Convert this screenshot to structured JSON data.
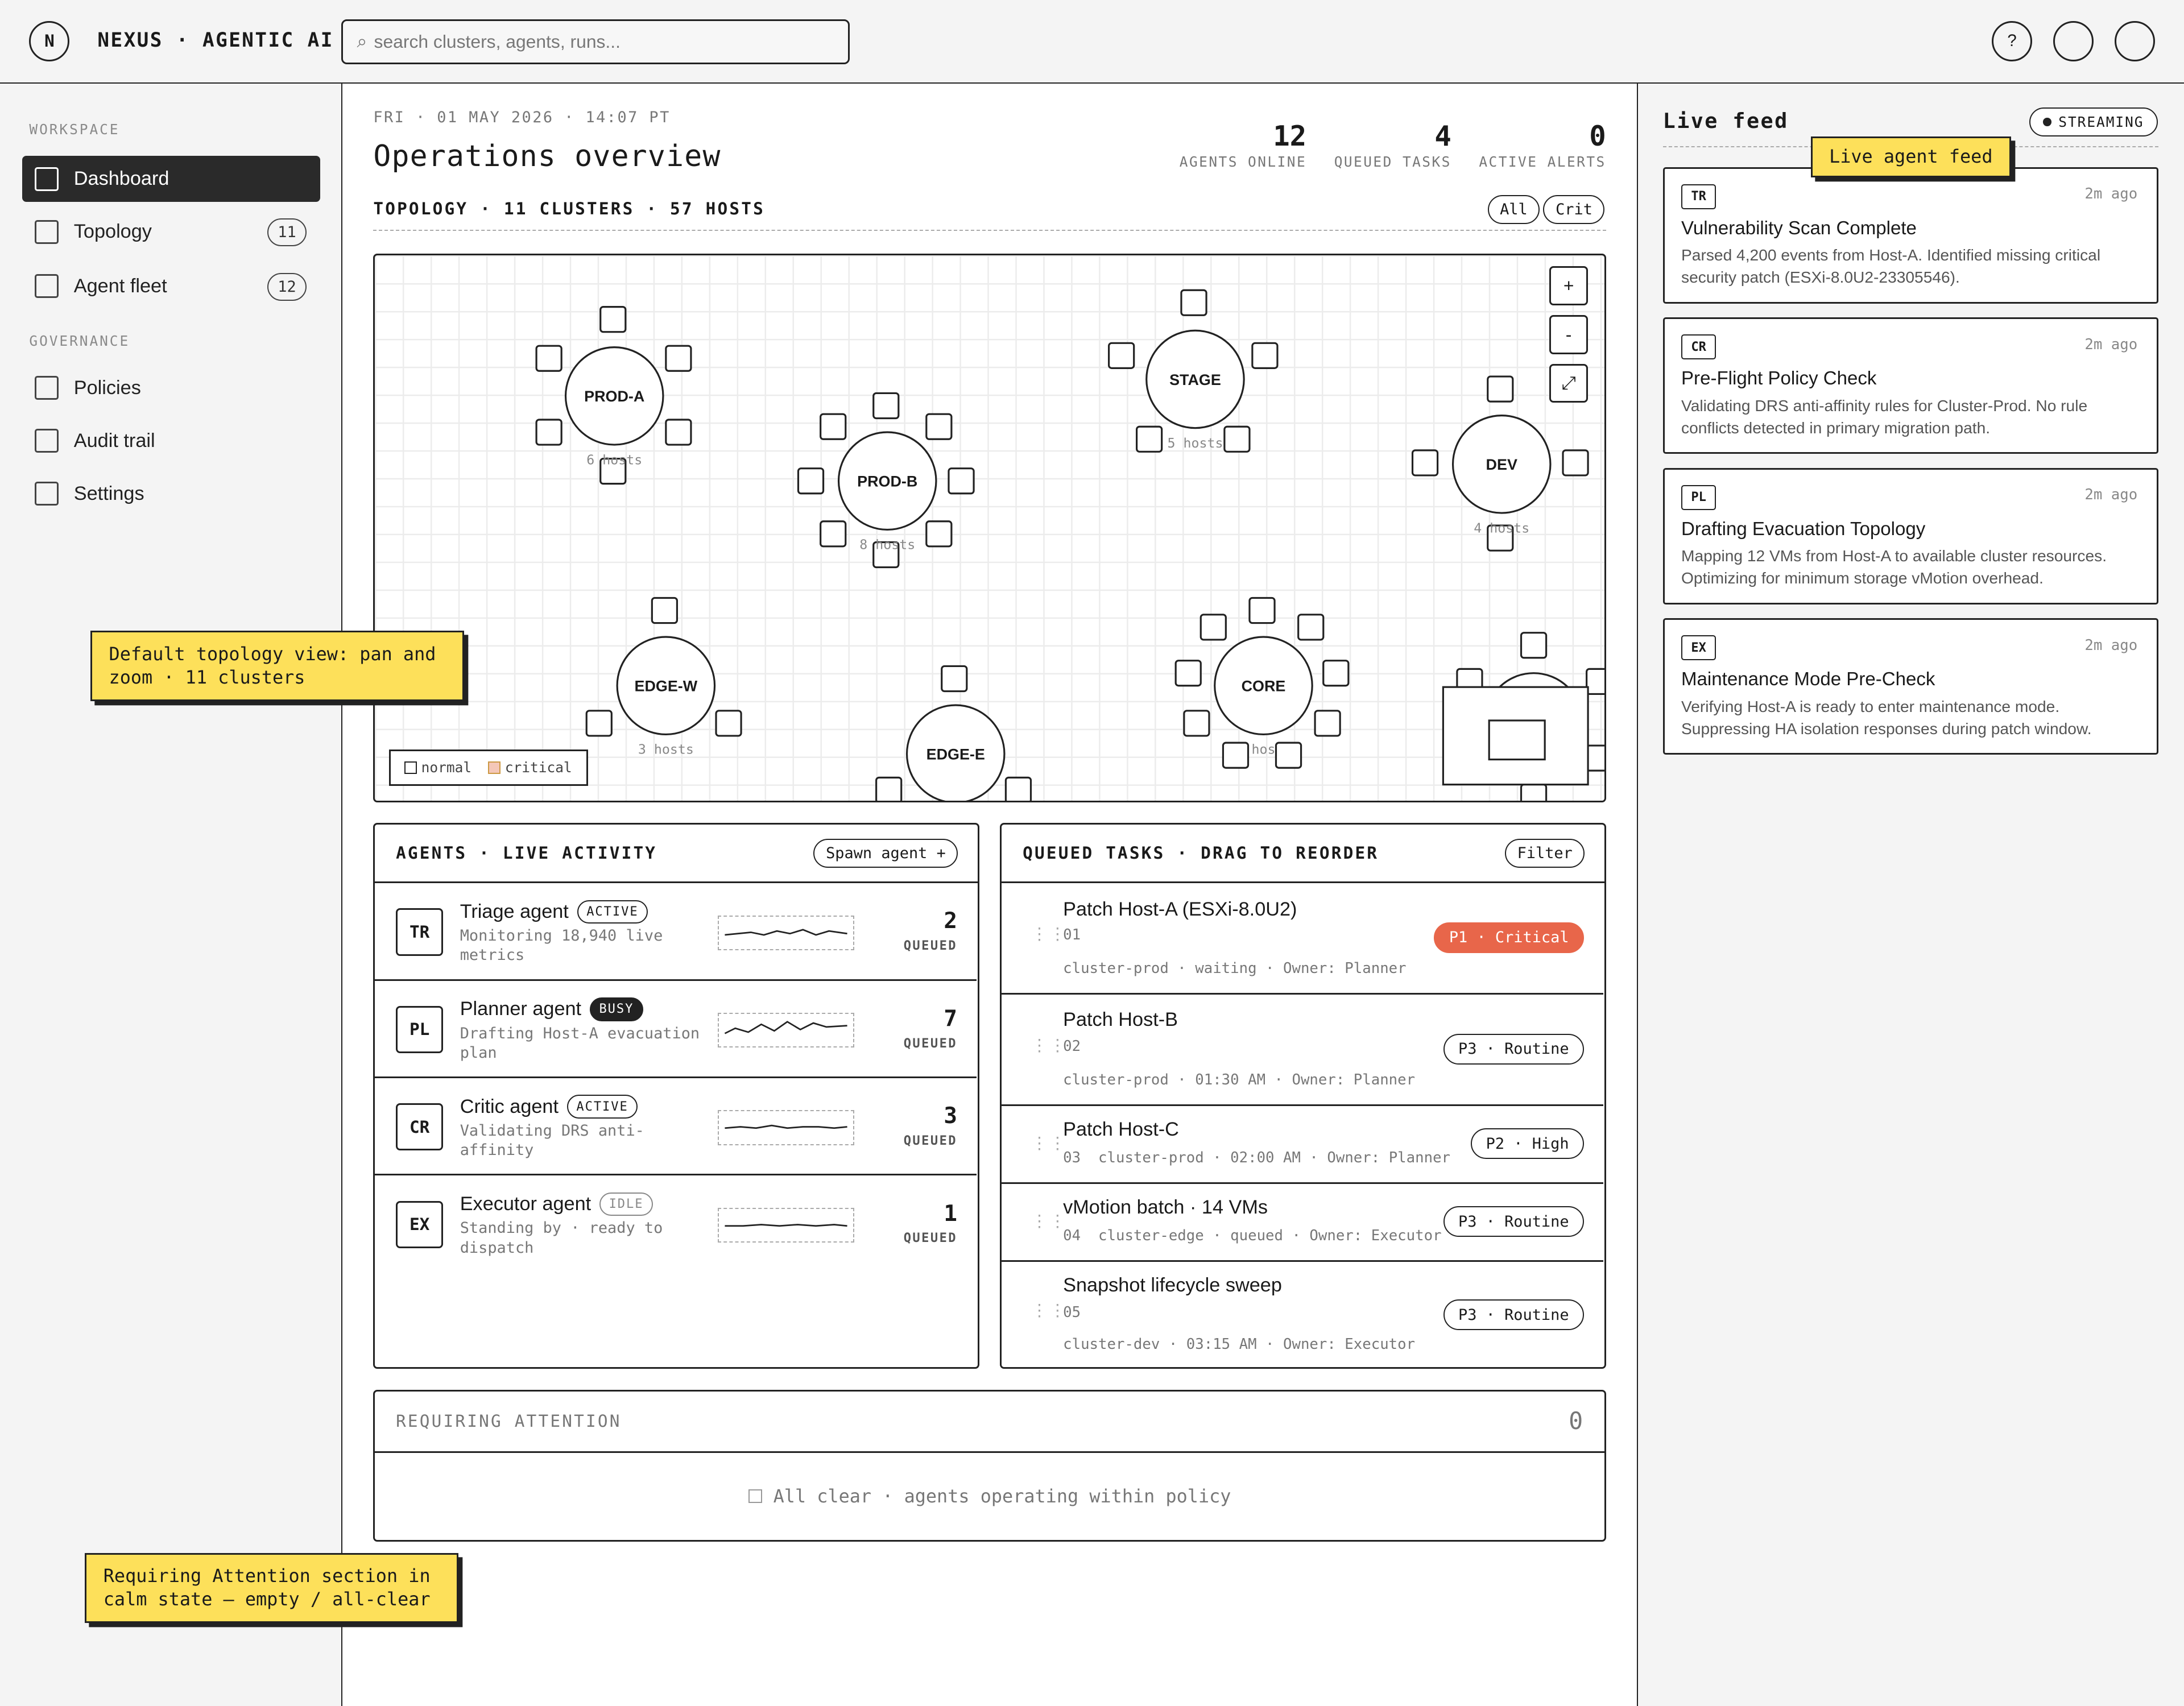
{
  "app": {
    "logo_letter": "N",
    "brand": "NEXUS · AGENTIC AI"
  },
  "search": {
    "placeholder": "search clusters, agents, runs...",
    "icon": "search-icon"
  },
  "header_buttons": {
    "help": "?"
  },
  "sidebar": {
    "workspace_label": "WORKSPACE",
    "governance_label": "GOVERNANCE",
    "items": [
      {
        "label": "Dashboard",
        "count": "",
        "active": true
      },
      {
        "label": "Topology",
        "count": "11"
      },
      {
        "label": "Agent fleet",
        "count": "12"
      },
      {
        "label": "Policies",
        "count": ""
      },
      {
        "label": "Audit trail",
        "count": ""
      },
      {
        "label": "Settings",
        "count": ""
      }
    ]
  },
  "main": {
    "date": "FRI · 01 MAY 2026 · 14:07 PT",
    "title": "Operations overview",
    "stats": [
      {
        "value": "12",
        "label": "AGENTS ONLINE"
      },
      {
        "value": "4",
        "label": "QUEUED TASKS"
      },
      {
        "value": "0",
        "label": "ACTIVE ALERTS"
      }
    ],
    "topology_heading": "TOPOLOGY · 11 CLUSTERS · 57 HOSTS",
    "filter_all": "All",
    "filter_crit": "Crit",
    "zoom_in": "+",
    "zoom_out": "-",
    "fit": "⤢",
    "legend_normal": "normal",
    "legend_critical": "critical",
    "clusters": [
      {
        "name": "PROD-A",
        "hosts": "6 hosts"
      },
      {
        "name": "PROD-B",
        "hosts": "8 hosts"
      },
      {
        "name": "STAGE",
        "hosts": "5 hosts"
      },
      {
        "name": "DEV",
        "hosts": "4 hosts"
      },
      {
        "name": "EDGE-W",
        "hosts": "3 hosts"
      },
      {
        "name": "EDGE-E",
        "hosts": ""
      },
      {
        "name": "CORE",
        "hosts": "hos"
      }
    ]
  },
  "agents_panel": {
    "title": "AGENTS · LIVE ACTIVITY",
    "spawn": "Spawn agent +",
    "queued_label": "QUEUED",
    "agents": [
      {
        "abbr": "TR",
        "name": "Triage agent",
        "status": "ACTIVE",
        "desc": "Monitoring 18,940 live metrics",
        "queued": "2"
      },
      {
        "abbr": "PL",
        "name": "Planner agent",
        "status": "BUSY",
        "desc": "Drafting Host-A evacuation plan",
        "queued": "7"
      },
      {
        "abbr": "CR",
        "name": "Critic agent",
        "status": "ACTIVE",
        "desc": "Validating DRS anti-affinity",
        "queued": "3"
      },
      {
        "abbr": "EX",
        "name": "Executor agent",
        "status": "IDLE",
        "desc": "Standing by · ready to dispatch",
        "queued": "1"
      }
    ]
  },
  "tasks_panel": {
    "title": "QUEUED TASKS · DRAG TO REORDER",
    "filter": "Filter",
    "tasks": [
      {
        "title": "Patch Host-A (ESXi-8.0U2)",
        "num": "01",
        "meta": "cluster-prod · waiting · Owner: Planner",
        "priority": "P1 · Critical"
      },
      {
        "title": "Patch Host-B",
        "num": "02",
        "meta": "cluster-prod · 01:30 AM · Owner: Planner",
        "priority": "P3 · Routine"
      },
      {
        "title": "Patch Host-C",
        "num": "03",
        "meta": "cluster-prod · 02:00 AM · Owner: Planner",
        "priority": "P2 · High"
      },
      {
        "title": "vMotion batch · 14 VMs",
        "num": "04",
        "meta": "cluster-edge · queued · Owner: Executor",
        "priority": "P3 · Routine"
      },
      {
        "title": "Snapshot lifecycle sweep",
        "num": "05",
        "meta": "cluster-dev · 03:15 AM · Owner: Executor",
        "priority": "P3 · Routine"
      }
    ]
  },
  "attention": {
    "title": "REQUIRING ATTENTION",
    "count": "0",
    "empty": "All clear · agents operating within policy"
  },
  "feed": {
    "title": "Live feed",
    "streaming": "STREAMING",
    "items": [
      {
        "abbr": "TR",
        "time": "2m ago",
        "title": "Vulnerability Scan Complete",
        "desc": "Parsed 4,200 events from Host-A. Identified missing critical security patch (ESXi-8.0U2-23305546)."
      },
      {
        "abbr": "CR",
        "time": "2m ago",
        "title": "Pre-Flight Policy Check",
        "desc": "Validating DRS anti-affinity rules for Cluster-Prod. No rule conflicts detected in primary migration path."
      },
      {
        "abbr": "PL",
        "time": "2m ago",
        "title": "Drafting Evacuation Topology",
        "desc": "Mapping 12 VMs from Host-A to available cluster resources. Optimizing for minimum storage vMotion overhead."
      },
      {
        "abbr": "EX",
        "time": "2m ago",
        "title": "Maintenance Mode Pre-Check",
        "desc": "Verifying Host-A is ready to enter maintenance mode. Suppressing HA isolation responses during patch window."
      }
    ]
  },
  "annotations": {
    "feed_note": "Live agent feed",
    "topology_note": "Default topology view: pan and zoom · 11 clusters",
    "attention_note": "Requiring Attention section in calm state — empty / all-clear"
  }
}
